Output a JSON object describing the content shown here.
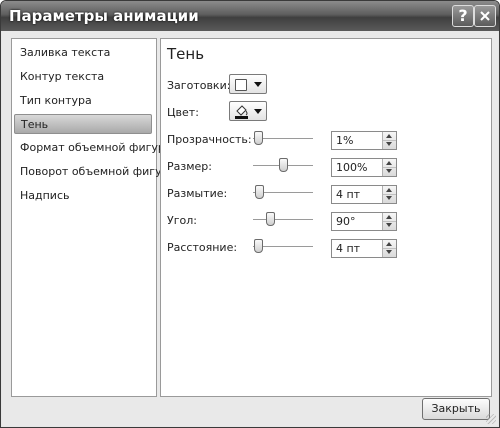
{
  "window": {
    "title": "Параметры анимации",
    "help_glyph": "?",
    "close_glyph": "X"
  },
  "sidebar": {
    "items": [
      {
        "label": "Заливка текста",
        "selected": false
      },
      {
        "label": "Контур текста",
        "selected": false
      },
      {
        "label": "Тип контура",
        "selected": false
      },
      {
        "label": "Тень",
        "selected": true
      },
      {
        "label": "Формат объемной фигуры",
        "selected": false
      },
      {
        "label": "Поворот объемной фигуры",
        "selected": false
      },
      {
        "label": "Надпись",
        "selected": false
      }
    ]
  },
  "main": {
    "title": "Тень",
    "presets_label": "Заготовки:",
    "color_label": "Цвет:",
    "properties": [
      {
        "label": "Прозрачность:",
        "value": "1%",
        "level": 0.01
      },
      {
        "label": "Размер:",
        "value": "100%",
        "level": 0.5
      },
      {
        "label": "Размытие:",
        "value": "4 пт",
        "level": 0.04
      },
      {
        "label": "Угол:",
        "value": "90°",
        "level": 0.25
      },
      {
        "label": "Расстояние:",
        "value": "4 пт",
        "level": 0.02
      }
    ]
  },
  "footer": {
    "close_label": "Закрыть"
  },
  "colors": {
    "titlebar": "#4a4a4a",
    "client_bg": "#e9e9e9",
    "selected_item": "#b8b8b8"
  }
}
